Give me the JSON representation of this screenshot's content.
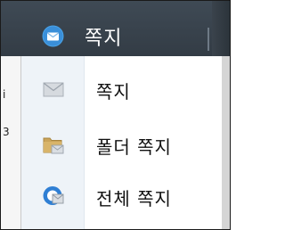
{
  "header": {
    "label": "쪽지",
    "icon": "message-bubble-icon"
  },
  "menu": {
    "items": [
      {
        "label": "쪽지",
        "icon": "envelope-icon"
      },
      {
        "label": "폴더 쪽지",
        "icon": "folder-envelope-icon"
      },
      {
        "label": "전체 쪽지",
        "icon": "all-messages-icon"
      }
    ]
  },
  "colors": {
    "header_bg": "#38424b",
    "menu_gutter": "#eef3f8",
    "accent_blue": "#2f7fd4",
    "folder_tan": "#c8a55c"
  }
}
